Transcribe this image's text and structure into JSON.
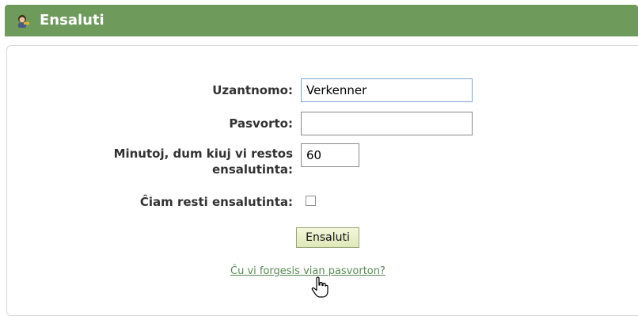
{
  "header": {
    "title": "Ensaluti",
    "icon": "user-key-icon",
    "bg_color": "#6e9a5c"
  },
  "form": {
    "username_label": "Uzantnomo:",
    "username_value": "Verkenner",
    "password_label": "Pasvorto:",
    "password_value": "",
    "minutes_label_line1": "Minutoj, dum kiuj vi restos",
    "minutes_label_line2": "ensalutinta:",
    "minutes_value": "60",
    "remember_label": "Ĉiam resti ensalutinta:",
    "remember_checked": false,
    "submit_label": "Ensaluti",
    "forgot_link": "Ĉu vi forgesis vian pasvorton?"
  },
  "cursor": "hand-pointer-icon"
}
